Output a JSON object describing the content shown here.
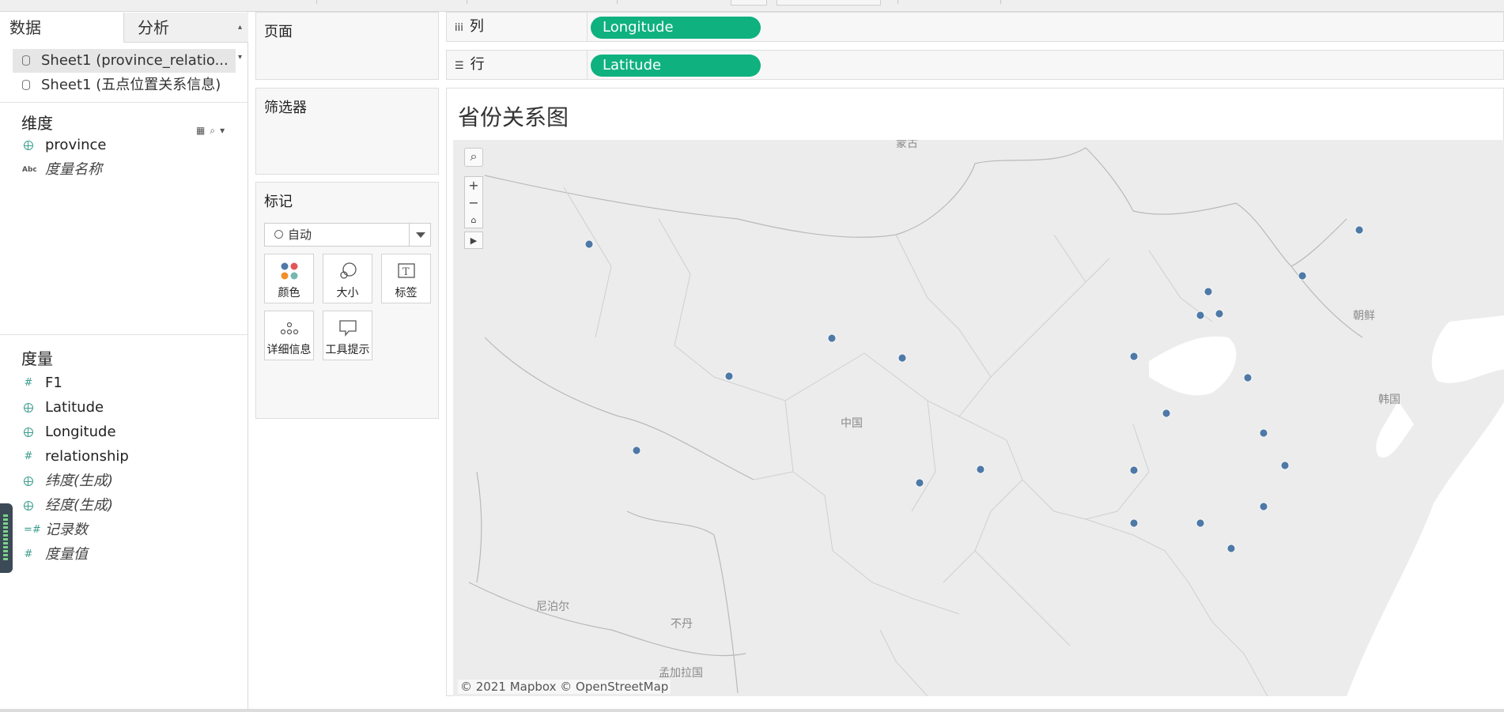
{
  "data_pane": {
    "tab_data": "数据",
    "tab_analysis": "分析",
    "sources": [
      "Sheet1 (province_relatio...",
      "Sheet1 (五点位置关系信息)"
    ],
    "dimensions_title": "维度",
    "dimensions": [
      {
        "label": "province",
        "icon": "globe-icon",
        "italic": false
      },
      {
        "label": "度量名称",
        "icon": "abc-icon",
        "italic": true
      }
    ],
    "measures_title": "度量",
    "measures": [
      {
        "label": "F1",
        "icon": "hash-icon",
        "italic": false
      },
      {
        "label": "Latitude",
        "icon": "globe-icon",
        "italic": false
      },
      {
        "label": "Longitude",
        "icon": "globe-icon",
        "italic": false
      },
      {
        "label": "relationship",
        "icon": "hash-icon",
        "italic": false
      },
      {
        "label": "纬度(生成)",
        "icon": "globe-icon",
        "italic": true
      },
      {
        "label": "经度(生成)",
        "icon": "globe-icon",
        "italic": true
      },
      {
        "label": "记录数",
        "icon": "hash-icon",
        "italic": true
      },
      {
        "label": "度量值",
        "icon": "hash-icon",
        "italic": true
      }
    ]
  },
  "shelves": {
    "pages_title": "页面",
    "filters_title": "筛选器",
    "marks_title": "标记",
    "mark_type": "自动",
    "mark_buttons": [
      "颜色",
      "大小",
      "标签",
      "详细信息",
      "工具提示"
    ],
    "columns_label": "列",
    "columns_pill": "Longitude",
    "rows_label": "行",
    "rows_pill": "Latitude"
  },
  "viz": {
    "title": "省份关系图",
    "map_labels": [
      "蒙古",
      "中国",
      "朝鲜",
      "韩国",
      "尼泊尔",
      "不丹",
      "孟加拉国"
    ],
    "attribution": "© 2021 Mapbox © OpenStreetMap",
    "zoom_in": "+",
    "zoom_out": "−",
    "colors": {
      "marks": "#4e79a7",
      "pill": "#0fb17e",
      "map_bg": "#ececec",
      "water": "#ffffff"
    }
  }
}
